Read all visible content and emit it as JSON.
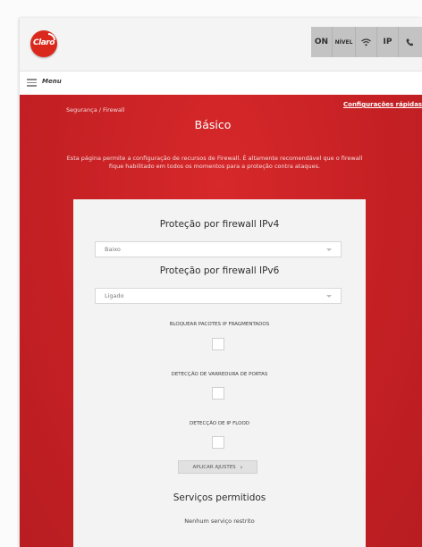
{
  "header": {
    "logo_text": "Claro",
    "status": {
      "on": "ON",
      "nivel": "NÍVEL",
      "ip": "IP"
    }
  },
  "menu": {
    "label": "Menu"
  },
  "breadcrumb": "Segurança / Firewall",
  "quick_config_link": "Configurações rápidas",
  "page_title": "Básico",
  "description": "Esta página permite a configuração de recursos de Firewall. É altamente recomendável que o firewall fique habilitado em todos os momentos para a proteção contra ataques.",
  "ipv4": {
    "heading": "Proteção por firewall IPv4",
    "selected": "Baixo"
  },
  "ipv6": {
    "heading": "Proteção por firewall IPv6",
    "selected": "Ligado"
  },
  "options": {
    "fragmented": {
      "label": "BLOQUEAR PACOTES IP FRAGMENTADOS",
      "checked": false
    },
    "port_scan": {
      "label": "DETECÇÃO DE VARREDURA DE PORTAS",
      "checked": false
    },
    "ip_flood": {
      "label": "DETECÇÃO DE IP FLOOD",
      "checked": false
    }
  },
  "apply_button": {
    "label": "APLICAR AJUSTES",
    "chevron": "›"
  },
  "services": {
    "heading": "Serviços permitidos",
    "empty_text": "Nenhum serviço restrito"
  },
  "colors": {
    "brand_red": "#da291c",
    "section_red": "#c42024",
    "status_gray": "#c3c3c3",
    "card_bg": "#f3f3f3"
  }
}
